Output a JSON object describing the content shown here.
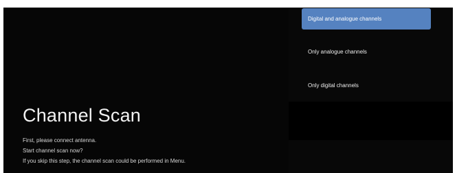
{
  "screen": {
    "title": "Channel Scan",
    "description_lines": [
      "First, please connect antenna.",
      "Start channel scan now?",
      "If you skip this step, the channel scan could be performed in Menu."
    ]
  },
  "menu": {
    "items": [
      {
        "label": "Digital and analogue channels",
        "selected": true
      },
      {
        "label": "Only analogue channels",
        "selected": false
      },
      {
        "label": "Only digital channels",
        "selected": false
      }
    ],
    "accent_color": "#5582c0",
    "background_color": "#060606"
  }
}
